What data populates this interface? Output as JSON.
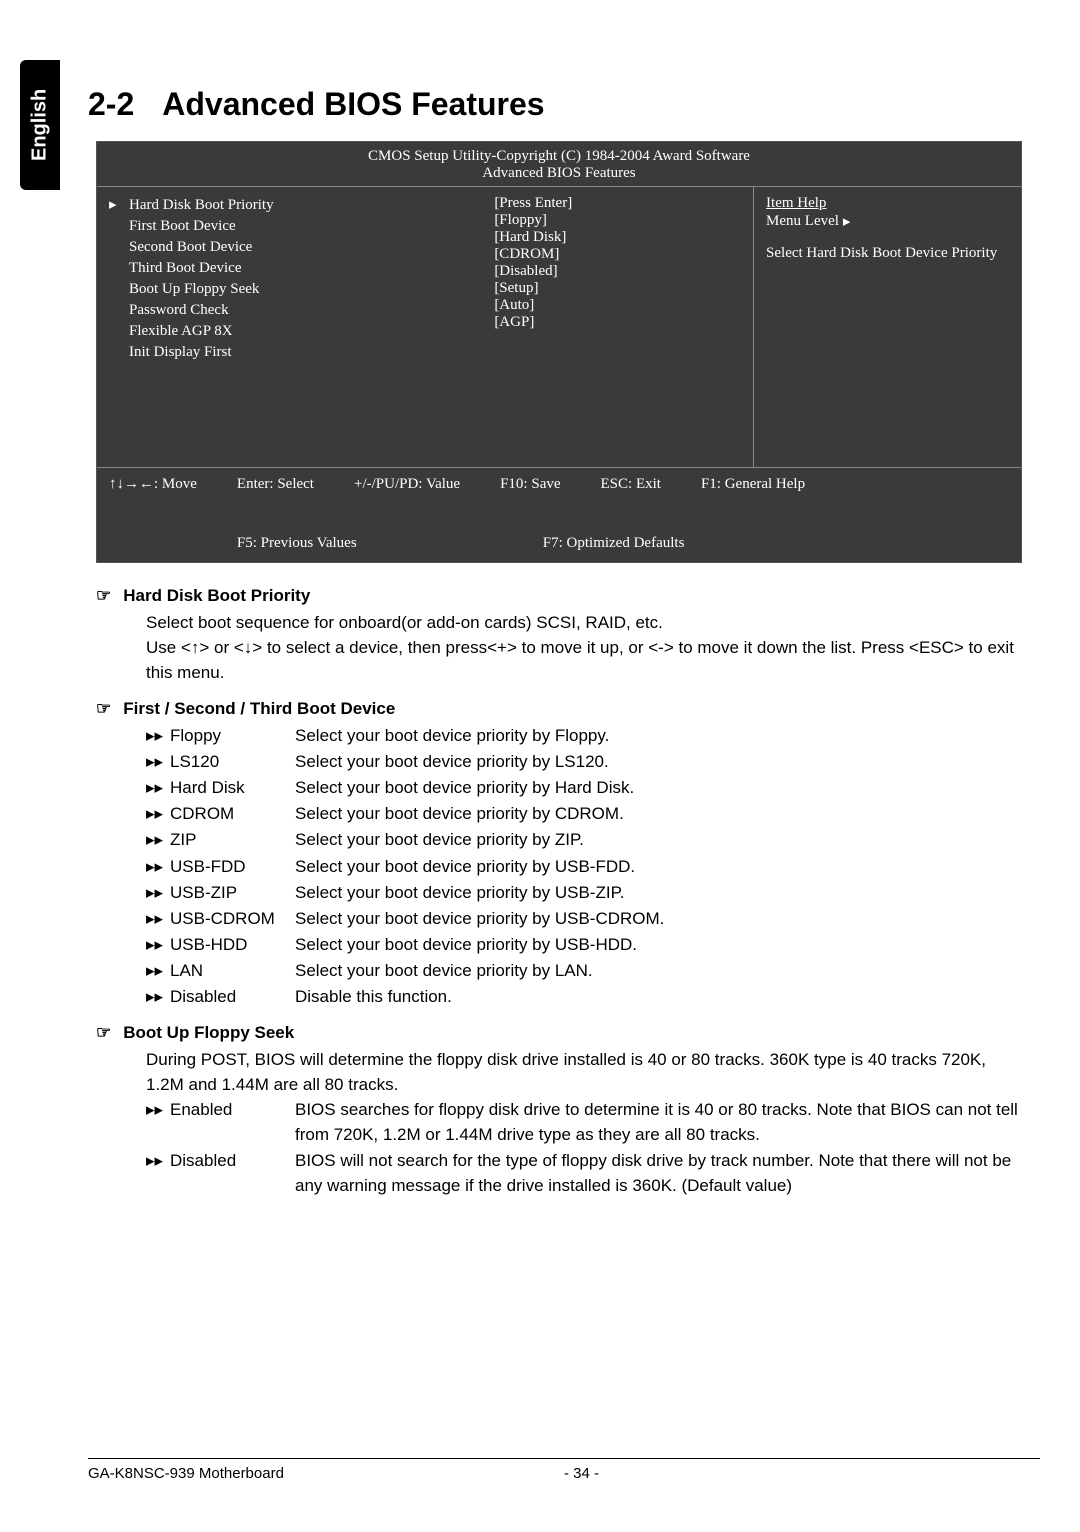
{
  "language_tab": "English",
  "heading": {
    "number": "2-2",
    "title": "Advanced BIOS Features"
  },
  "bios": {
    "copyright": "CMOS Setup Utility-Copyright (C) 1984-2004 Award Software",
    "subtitle": "Advanced BIOS Features",
    "items": [
      {
        "label": "Hard Disk Boot Priority",
        "value": "[Press Enter]",
        "pointer": true
      },
      {
        "label": "First Boot Device",
        "value": "[Floppy]"
      },
      {
        "label": "Second Boot Device",
        "value": "[Hard Disk]"
      },
      {
        "label": "Third Boot Device",
        "value": "[CDROM]"
      },
      {
        "label": "Boot Up Floppy Seek",
        "value": "[Disabled]"
      },
      {
        "label": "Password Check",
        "value": "[Setup]"
      },
      {
        "label": "Flexible AGP 8X",
        "value": "[Auto]"
      },
      {
        "label": "Init Display First",
        "value": "[AGP]"
      }
    ],
    "help": {
      "title": "Item Help",
      "menu_level": "Menu Level",
      "text": "Select Hard Disk Boot Device Priority"
    },
    "footer": {
      "move": "↑↓→←: Move",
      "enter": "Enter: Select",
      "value": "+/-/PU/PD: Value",
      "save": "F10: Save",
      "esc": "ESC: Exit",
      "help": "F1: General Help",
      "prev": "F5: Previous Values",
      "defaults": "F7: Optimized Defaults"
    }
  },
  "sections": [
    {
      "title": "Hard Disk Boot Priority",
      "paragraphs": [
        "Select boot sequence for onboard(or add-on cards) SCSI, RAID, etc.",
        "Use <↑> or <↓> to select a device, then press<+> to move it up, or <-> to move it down the list. Press <ESC> to exit this menu."
      ]
    },
    {
      "title": "First / Second / Third Boot Device",
      "options": [
        {
          "name": "Floppy",
          "desc": "Select your boot device priority by Floppy."
        },
        {
          "name": "LS120",
          "desc": "Select your boot device priority by LS120."
        },
        {
          "name": "Hard Disk",
          "desc": "Select your boot device priority by Hard Disk."
        },
        {
          "name": "CDROM",
          "desc": "Select your boot device priority by CDROM."
        },
        {
          "name": "ZIP",
          "desc": "Select your boot device priority by ZIP."
        },
        {
          "name": "USB-FDD",
          "desc": "Select your boot device priority by USB-FDD."
        },
        {
          "name": "USB-ZIP",
          "desc": "Select your boot device priority by USB-ZIP."
        },
        {
          "name": "USB-CDROM",
          "desc": "Select your boot device priority by USB-CDROM."
        },
        {
          "name": "USB-HDD",
          "desc": "Select your boot device priority by USB-HDD."
        },
        {
          "name": "LAN",
          "desc": "Select your boot device priority by LAN."
        },
        {
          "name": "Disabled",
          "desc": "Disable this function."
        }
      ]
    },
    {
      "title": "Boot Up Floppy Seek",
      "paragraphs": [
        "During POST, BIOS will determine the floppy disk drive installed is 40 or 80 tracks. 360K type is 40 tracks 720K, 1.2M and 1.44M are all 80 tracks."
      ],
      "options": [
        {
          "name": "Enabled",
          "desc": "BIOS searches for floppy disk drive to determine it is 40 or 80 tracks. Note that BIOS can not tell from 720K, 1.2M or 1.44M drive type as they are all 80 tracks."
        },
        {
          "name": "Disabled",
          "desc": "BIOS will not search for the type of floppy disk drive by track number. Note that there will not be any warning message if the drive installed is 360K. (Default value)"
        }
      ]
    }
  ],
  "footer": {
    "motherboard": "GA-K8NSC-939 Motherboard",
    "page": "- 34 -"
  }
}
